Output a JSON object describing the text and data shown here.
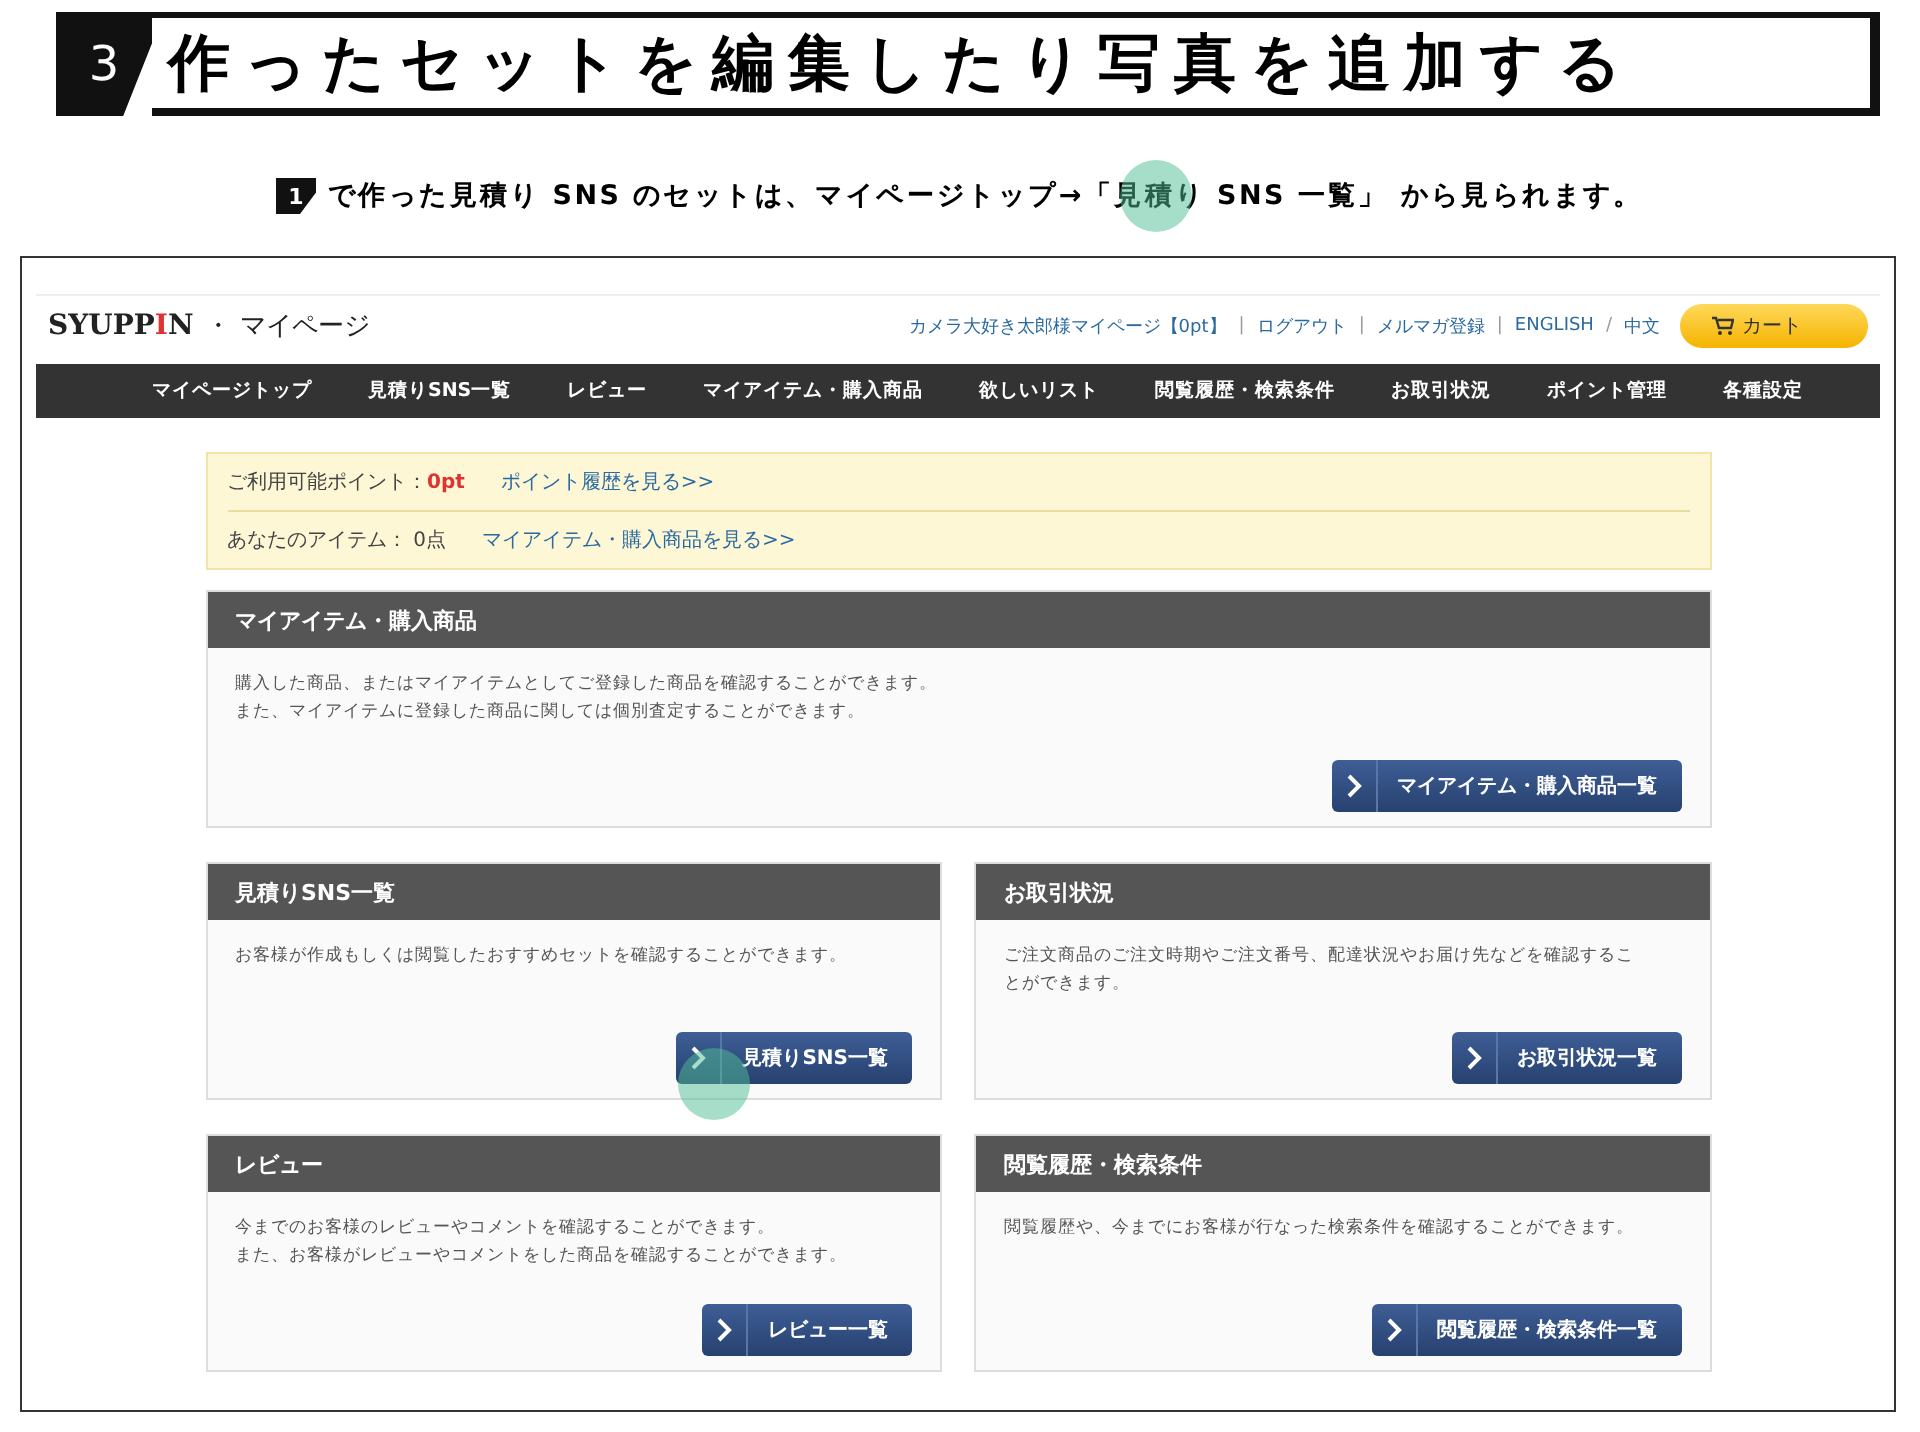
{
  "heading": {
    "number": "3",
    "title": "作ったセットを編集したり写真を追加する"
  },
  "instruction": {
    "step": "1",
    "text": "で作った見積り SNS のセットは、マイページトップ→「見積り SNS 一覧」 から見られます。",
    "highlight": true
  },
  "site": {
    "logo_parts": [
      "SYUPP",
      "I",
      "N"
    ],
    "page_name": "・ マイページ",
    "links": [
      {
        "label": "カメラ大好き太郎様マイページ【0pt】",
        "separator": "|"
      },
      {
        "label": "ログアウト",
        "separator": "|"
      },
      {
        "label": "メルマガ登録",
        "separator": "|"
      },
      {
        "label": "ENGLISH",
        "separator": "/"
      },
      {
        "label": "中文"
      }
    ],
    "cart": "カート",
    "nav": [
      "マイページトップ",
      "見積りSNS一覧",
      "レビュー",
      "マイアイテム・購入商品",
      "欲しいリスト",
      "閲覧履歴・検索条件",
      "お取引状況",
      "ポイント管理",
      "各種設定"
    ]
  },
  "summary": {
    "points_label": "ご利用可能ポイント：",
    "points_value": "0pt",
    "points_link": "ポイント履歴を見る>>",
    "items_label": "あなたのアイテム： 0点",
    "items_link": "マイアイテム・購入商品を見る>>"
  },
  "sections": [
    {
      "kind": "wide",
      "title": "マイアイテム・購入商品",
      "lines": [
        "購入した商品、またはマイアイテムとしてご登録した商品を確認することができます。",
        "また、マイアイテムに登録した商品に関しては個別査定することができます。"
      ],
      "button": "マイアイテム・購入商品一覧",
      "highlight": false
    },
    {
      "kind": "half",
      "title": "見積りSNS一覧",
      "lines": [
        "お客様が作成もしくは閲覧したおすすめセットを確認することができます。"
      ],
      "button": "見積りSNS一覧",
      "highlight": true
    },
    {
      "kind": "half",
      "title": "お取引状況",
      "lines": [
        "ご注文商品のご注文時期やご注文番号、配達状況やお届け先などを確認するこ",
        "とができます。"
      ],
      "button": "お取引状況一覧",
      "highlight": false
    },
    {
      "kind": "half",
      "title": "レビュー",
      "lines": [
        "今までのお客様のレビューやコメントを確認することができます。",
        "また、お客様がレビューやコメントをした商品を確認することができます。"
      ],
      "button": "レビュー一覧",
      "highlight": false
    },
    {
      "kind": "half",
      "title": "閲覧履歴・検索条件",
      "lines": [
        "閲覧履歴や、今までにお客様が行なった検索条件を確認することができます。"
      ],
      "button": "閲覧履歴・検索条件一覧",
      "highlight": false
    }
  ]
}
